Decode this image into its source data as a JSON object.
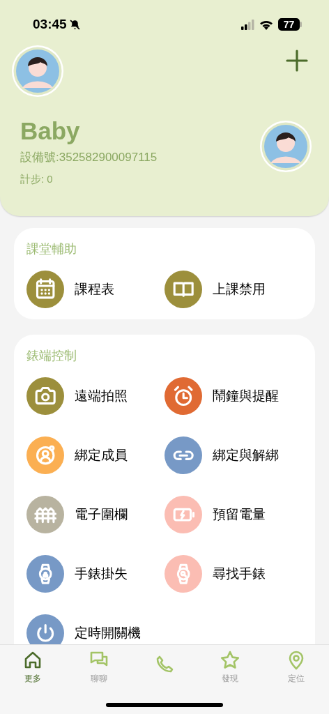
{
  "status_bar": {
    "time": "03:45",
    "battery": "77"
  },
  "profile": {
    "name": "Baby",
    "device": "設備號:352582900097115",
    "steps": "計步: 0"
  },
  "sections": [
    {
      "title": "課堂輔助",
      "items": [
        {
          "label": "課程表",
          "color": "#9c8f3c"
        },
        {
          "label": "上課禁用",
          "color": "#9c8f3c"
        }
      ]
    },
    {
      "title": "錶端控制",
      "items": [
        {
          "label": "遠端拍照",
          "color": "#9c8f3c"
        },
        {
          "label": "鬧鐘與提醒",
          "color": "#e06a33"
        },
        {
          "label": "綁定成員",
          "color": "#fbaf52"
        },
        {
          "label": "綁定與解綁",
          "color": "#7799c6"
        },
        {
          "label": "電子圍欄",
          "color": "#b8b3a0"
        },
        {
          "label": "預留電量",
          "color": "#fbbdb3"
        },
        {
          "label": "手錶掛失",
          "color": "#7799c6"
        },
        {
          "label": "尋找手錶",
          "color": "#fbbdb3"
        },
        {
          "label": "定時開關機",
          "color": "#7799c6"
        }
      ]
    }
  ],
  "tabs": [
    {
      "label": "更多",
      "selected": true
    },
    {
      "label": "聊聊",
      "selected": false
    },
    {
      "selected": false
    },
    {
      "label": "發現",
      "selected": false
    },
    {
      "label": "定位",
      "selected": false
    }
  ]
}
